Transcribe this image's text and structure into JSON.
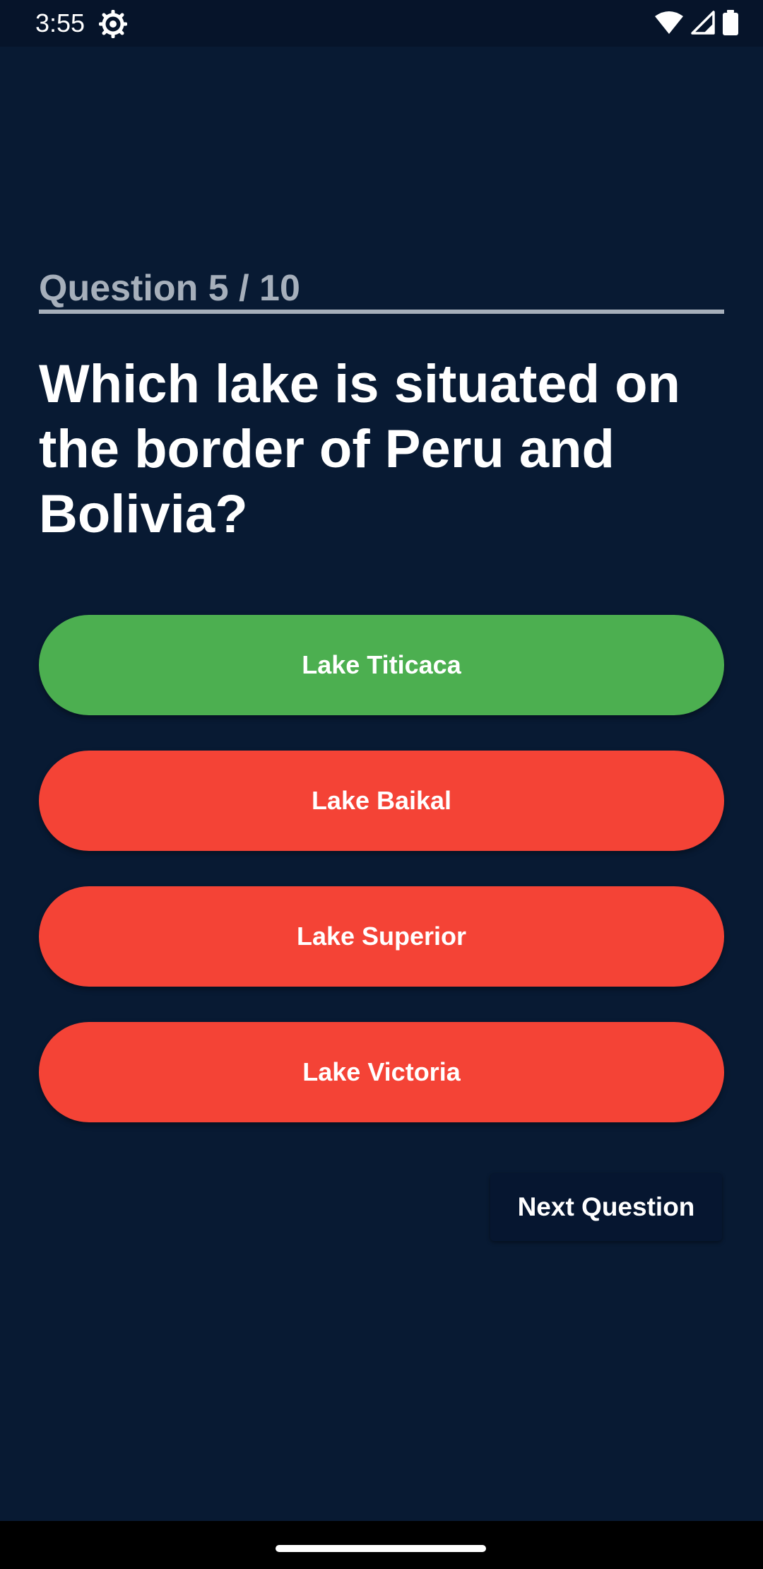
{
  "status_bar": {
    "time": "3:55",
    "icons": [
      "settings-gear-icon",
      "wifi-icon",
      "signal-icon",
      "battery-icon"
    ]
  },
  "quiz": {
    "counter": "Question 5 / 10",
    "question": "Which lake is situated on the border of Peru and Bolivia?",
    "answers": [
      {
        "label": "Lake Titicaca",
        "state": "correct"
      },
      {
        "label": "Lake Baikal",
        "state": "wrong"
      },
      {
        "label": "Lake Superior",
        "state": "wrong"
      },
      {
        "label": "Lake Victoria",
        "state": "wrong"
      }
    ],
    "next_label": "Next Question"
  },
  "colors": {
    "background": "#081A33",
    "correct": "#4CAF50",
    "wrong": "#F44336",
    "counter_text": "#A6AFBB"
  }
}
